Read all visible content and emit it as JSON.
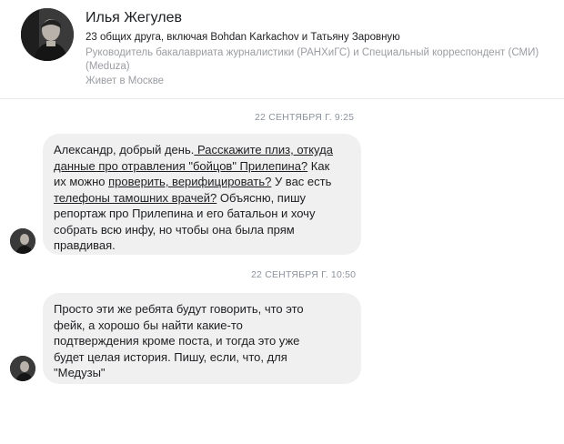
{
  "profile": {
    "name": "Илья Жегулев",
    "mutual_friends": "23 общих друга, включая Bohdan Karkachov и Татьяну Заровную",
    "job_line1": "Руководитель бакалавриата журналистики (РАНХиГС) и Специальный корреспондент (СМИ)",
    "job_line2": "(Meduza)",
    "location": "Живет в Москве"
  },
  "messages": [
    {
      "timestamp": "22 СЕНТЯБРЯ Г. 9:25",
      "lines": {
        "l1a": "Александр, добрый день.",
        "l1b": " Расскажите плиз, откуда",
        "l2a": "данные про отравления \"бойцов\" Прилепина?",
        "l2b": " Как",
        "l3a": "их можно ",
        "l3b": "проверить, верифицировать?",
        "l3c": " У вас есть",
        "l4a": "телефоны тамошних врачей?",
        "l4b": " Объясню, пишу",
        "l5": "репортаж про Прилепина и его батальон и хочу",
        "l6": "собрать всю инфу, но чтобы она была прям",
        "l7": "правдивая."
      }
    },
    {
      "timestamp": "22 СЕНТЯБРЯ Г. 10:50",
      "lines": {
        "l1": "Просто эти же ребята будут говорить, что это",
        "l2": "фейк, а хорошо бы найти какие-то",
        "l3": "подтверждения кроме поста, и тогда это уже",
        "l4": "будет целая история. Пишу, если, что, для",
        "l5": "\"Медузы\""
      }
    }
  ]
}
